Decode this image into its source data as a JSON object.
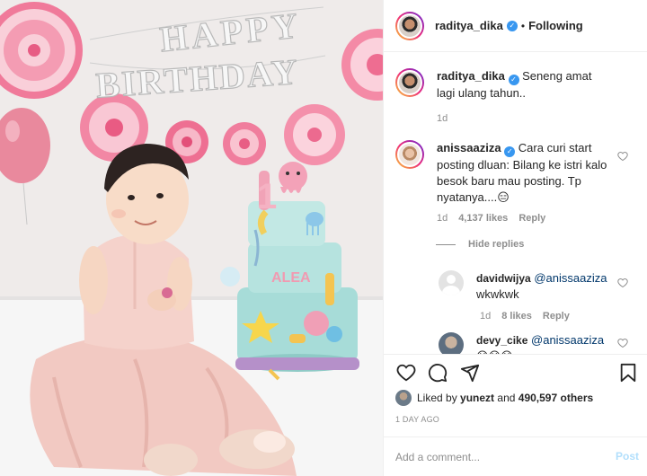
{
  "header": {
    "username": "raditya_dika",
    "separator": "•",
    "follow_status": "Following"
  },
  "banner": {
    "letters_line1": "HAPPY",
    "letters_line2": "BIRTHDAY"
  },
  "cake": {
    "number": "1",
    "name": "ALEA"
  },
  "caption": {
    "username": "raditya_dika",
    "text": "Seneng amat lagi ulang tahun..",
    "time": "1d"
  },
  "comments": [
    {
      "username": "anissaaziza",
      "text": "Cara curi start posting dluan: Bilang ke istri kalo besok baru mau posting. Tp nyatanya....😑",
      "time": "1d",
      "likes": "4,137 likes",
      "reply": "Reply"
    }
  ],
  "hide_replies": "Hide replies",
  "replies": [
    {
      "username": "davidwijya",
      "mention": "@anissaaziza",
      "text": "wkwkwk",
      "time": "1d",
      "likes": "8 likes",
      "reply": "Reply"
    },
    {
      "username": "devy_cike",
      "mention": "@anissaaziza",
      "text": "😆😆😆"
    }
  ],
  "liked_by": {
    "prefix": "Liked by",
    "user": "yunezt",
    "and": "and",
    "others": "490,597 others"
  },
  "timestamp": "1 DAY AGO",
  "add_comment": {
    "placeholder": "Add a comment...",
    "post_label": "Post"
  },
  "icons": [
    "heart-icon",
    "comment-icon",
    "share-icon",
    "bookmark-icon",
    "verified-icon"
  ],
  "colors": {
    "verified": "#3897f0",
    "post_button_disabled": "#b2dffc",
    "muted_text": "#8e8e8e"
  }
}
